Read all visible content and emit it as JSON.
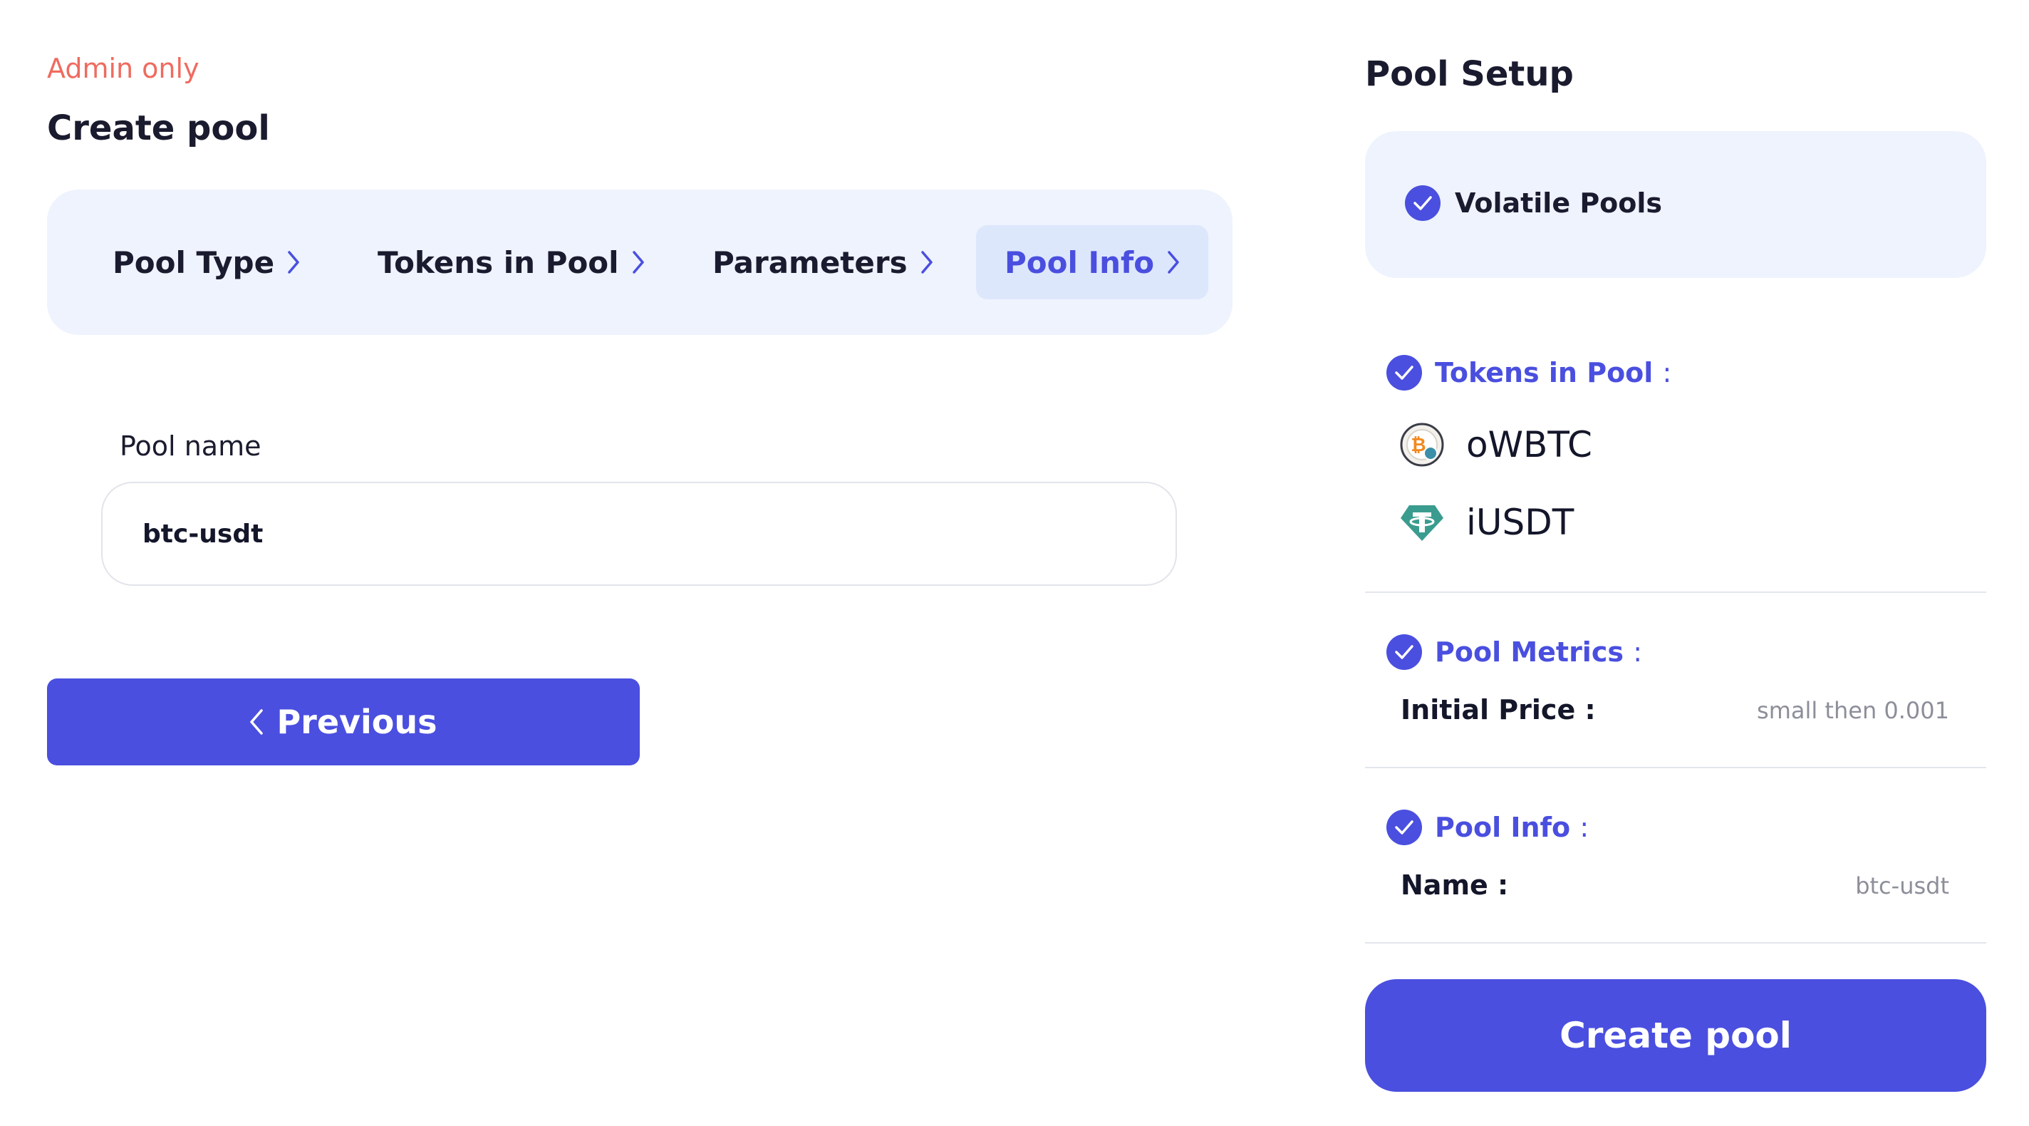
{
  "left": {
    "admin_label": "Admin only",
    "title": "Create pool",
    "steps": [
      {
        "label": "Pool Type",
        "active": false
      },
      {
        "label": "Tokens in Pool",
        "active": false
      },
      {
        "label": "Parameters",
        "active": false
      },
      {
        "label": "Pool Info",
        "active": true
      }
    ],
    "pool_name_label": "Pool name",
    "pool_name_value": "btc-usdt",
    "previous_label": "Previous"
  },
  "right": {
    "title": "Pool Setup",
    "pool_type": "Volatile Pools",
    "tokens_heading": "Tokens in Pool",
    "tokens": [
      {
        "symbol": "oWBTC",
        "icon": "bitcoin-icon"
      },
      {
        "symbol": "iUSDT",
        "icon": "tether-icon"
      }
    ],
    "metrics_heading": "Pool Metrics",
    "initial_price_label": "Initial Price :",
    "initial_price_value": "small then 0.001",
    "info_heading": "Pool Info",
    "name_label": "Name :",
    "name_value": "btc-usdt",
    "create_label": "Create pool"
  },
  "colon": ":",
  "colors": {
    "accent": "#4a4fdf",
    "panel_bg": "#eef3fd",
    "active_step_bg": "#dde7fc",
    "admin_text": "#ef6b5f",
    "muted_text": "#8c8f99"
  }
}
